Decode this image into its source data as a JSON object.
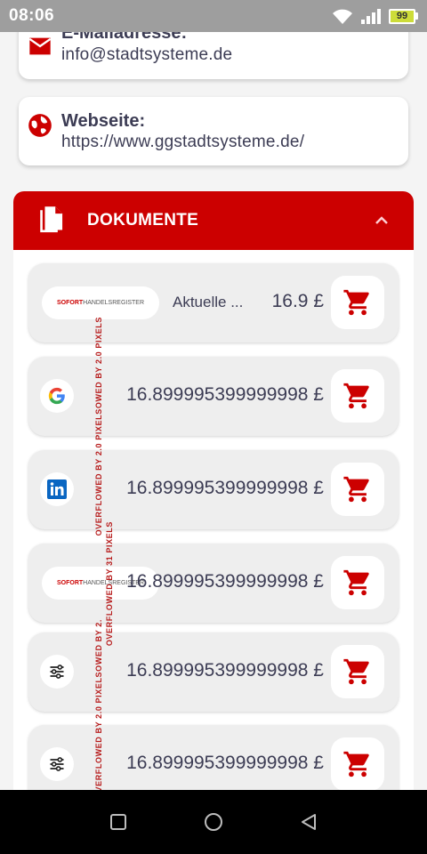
{
  "status_bar": {
    "time": "08:06",
    "battery": "99",
    "icons": [
      "wifi-icon",
      "signal-icon",
      "battery-icon"
    ]
  },
  "contact": {
    "email_label": "E-Mailadresse:",
    "email_value": "info@stadtsysteme.de",
    "website_label": "Webseite:",
    "website_value": "https://www.ggstadtsysteme.de/"
  },
  "documents": {
    "title": "DOKUMENTE",
    "items": [
      {
        "logo": "sofort-handelsregister",
        "logo_text_a": "SOFORT",
        "logo_text_b": "HANDELSREGISTER",
        "name": "Aktuelle ...",
        "price": "16.9 £"
      },
      {
        "logo": "google-icon",
        "name": "",
        "price": "16.899995399999998 £"
      },
      {
        "logo": "linkedin-icon",
        "name": "",
        "price": "16.899995399999998 £"
      },
      {
        "logo": "sofort-handelsregister",
        "logo_text_a": "SOFORT",
        "logo_text_b": "HANDELSREGISTER",
        "name": "",
        "price": "16.899995399999998 £"
      },
      {
        "logo": "sliders-icon",
        "name": "",
        "price": "16.899995399999998 £"
      },
      {
        "logo": "sliders-icon",
        "name": "",
        "price": "16.899995399999998 £"
      }
    ]
  },
  "overflow_warnings": {
    "a": "OVERFLOWED BY 2.0 PIXELSOWED BY 2.0 PIXELS",
    "b": "OVERFLOWED BY 31 PIXELS",
    "c": "OVERFLOWED BY 2.0 PIXELSOWED BY 2."
  },
  "colors": {
    "accent": "#cc0000",
    "text": "#3c3c54",
    "card": "#eeeeee",
    "status_bar": "#9e9e9e"
  }
}
